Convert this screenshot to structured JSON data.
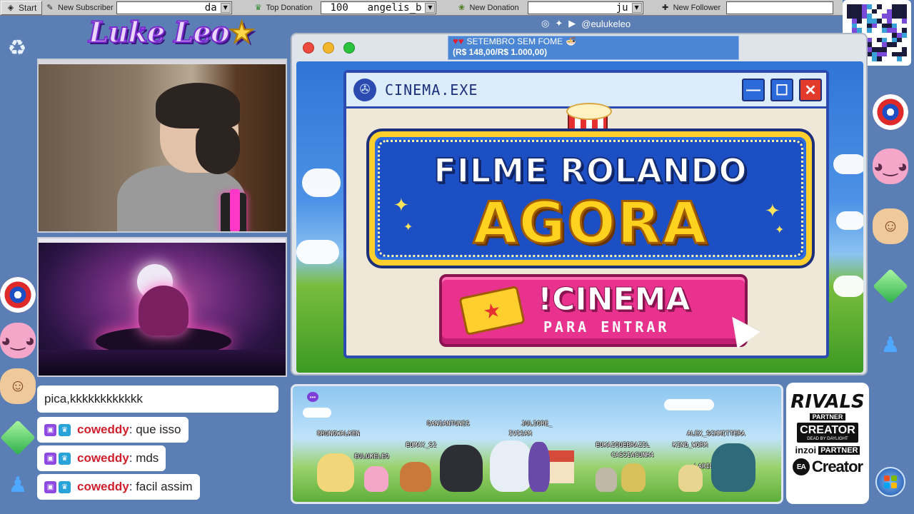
{
  "taskbar": {
    "start_label": "Start",
    "new_subscriber_label": "New Subscriber",
    "new_subscriber_value": "da",
    "top_donation_label": "Top Donation",
    "top_donation_amount": "100",
    "top_donation_user": "angelis_b",
    "new_donation_label": "New Donation",
    "new_donation_value": "ju",
    "new_follower_label": "New Follower",
    "new_follower_value": ""
  },
  "social": {
    "handle": "@eulukeleo",
    "icons": [
      "instagram-icon",
      "twitter-icon",
      "youtube-icon"
    ]
  },
  "logo": {
    "text": "Luke Leo",
    "star_glyph": "★"
  },
  "goal": {
    "hearts": "♥♥",
    "title": "SETEMBRO SEM FOME",
    "amount": "(R$ 148,00/R$ 1.000,00)"
  },
  "cinema": {
    "window_title": "CINEMA.EXE",
    "headline_line1": "FILME ROLANDO",
    "headline_line2": "AGORA",
    "command": "!CINEMA",
    "command_sub": "PARA ENTRAR",
    "minimize_glyph": "—",
    "maximize_glyph": "☐",
    "close_glyph": "✕"
  },
  "chat": {
    "partial_top": "pica,kkkkkkkkkkkk",
    "messages": [
      {
        "user": "coweddy",
        "text": ": que isso"
      },
      {
        "user": "coweddy",
        "text": ": mds"
      },
      {
        "user": "coweddy",
        "text": ": facil assim"
      }
    ]
  },
  "pokemon_names": [
    "BRUNOWALKEN",
    "DANIANTUNES",
    "JULIORE_",
    "EULUKELEO",
    "EUMAY_S2",
    "IVISAM",
    "EUKAIQUEBRAZIL",
    "ALEX_SCHMITTERA",
    "CASSIACUNH4",
    "KIND_WORM",
    "LARIDRIP"
  ],
  "partners": {
    "rivals_logo": "RIVALS",
    "rivals_tag": "PARTNER",
    "creator_big": "CREATOR",
    "creator_small": "DEAD BY DAYLIGHT",
    "inzoi": "inzoi",
    "inzoi_tag": "PARTNER",
    "ea_mark": "EA",
    "ea_text": "Creator"
  },
  "colors": {
    "desktop": "#5b7fb5",
    "accent_blue": "#2b4bb0",
    "accent_pink": "#e8328e",
    "accent_gold": "#ffd21f",
    "chat_user": "#d21f2d"
  }
}
